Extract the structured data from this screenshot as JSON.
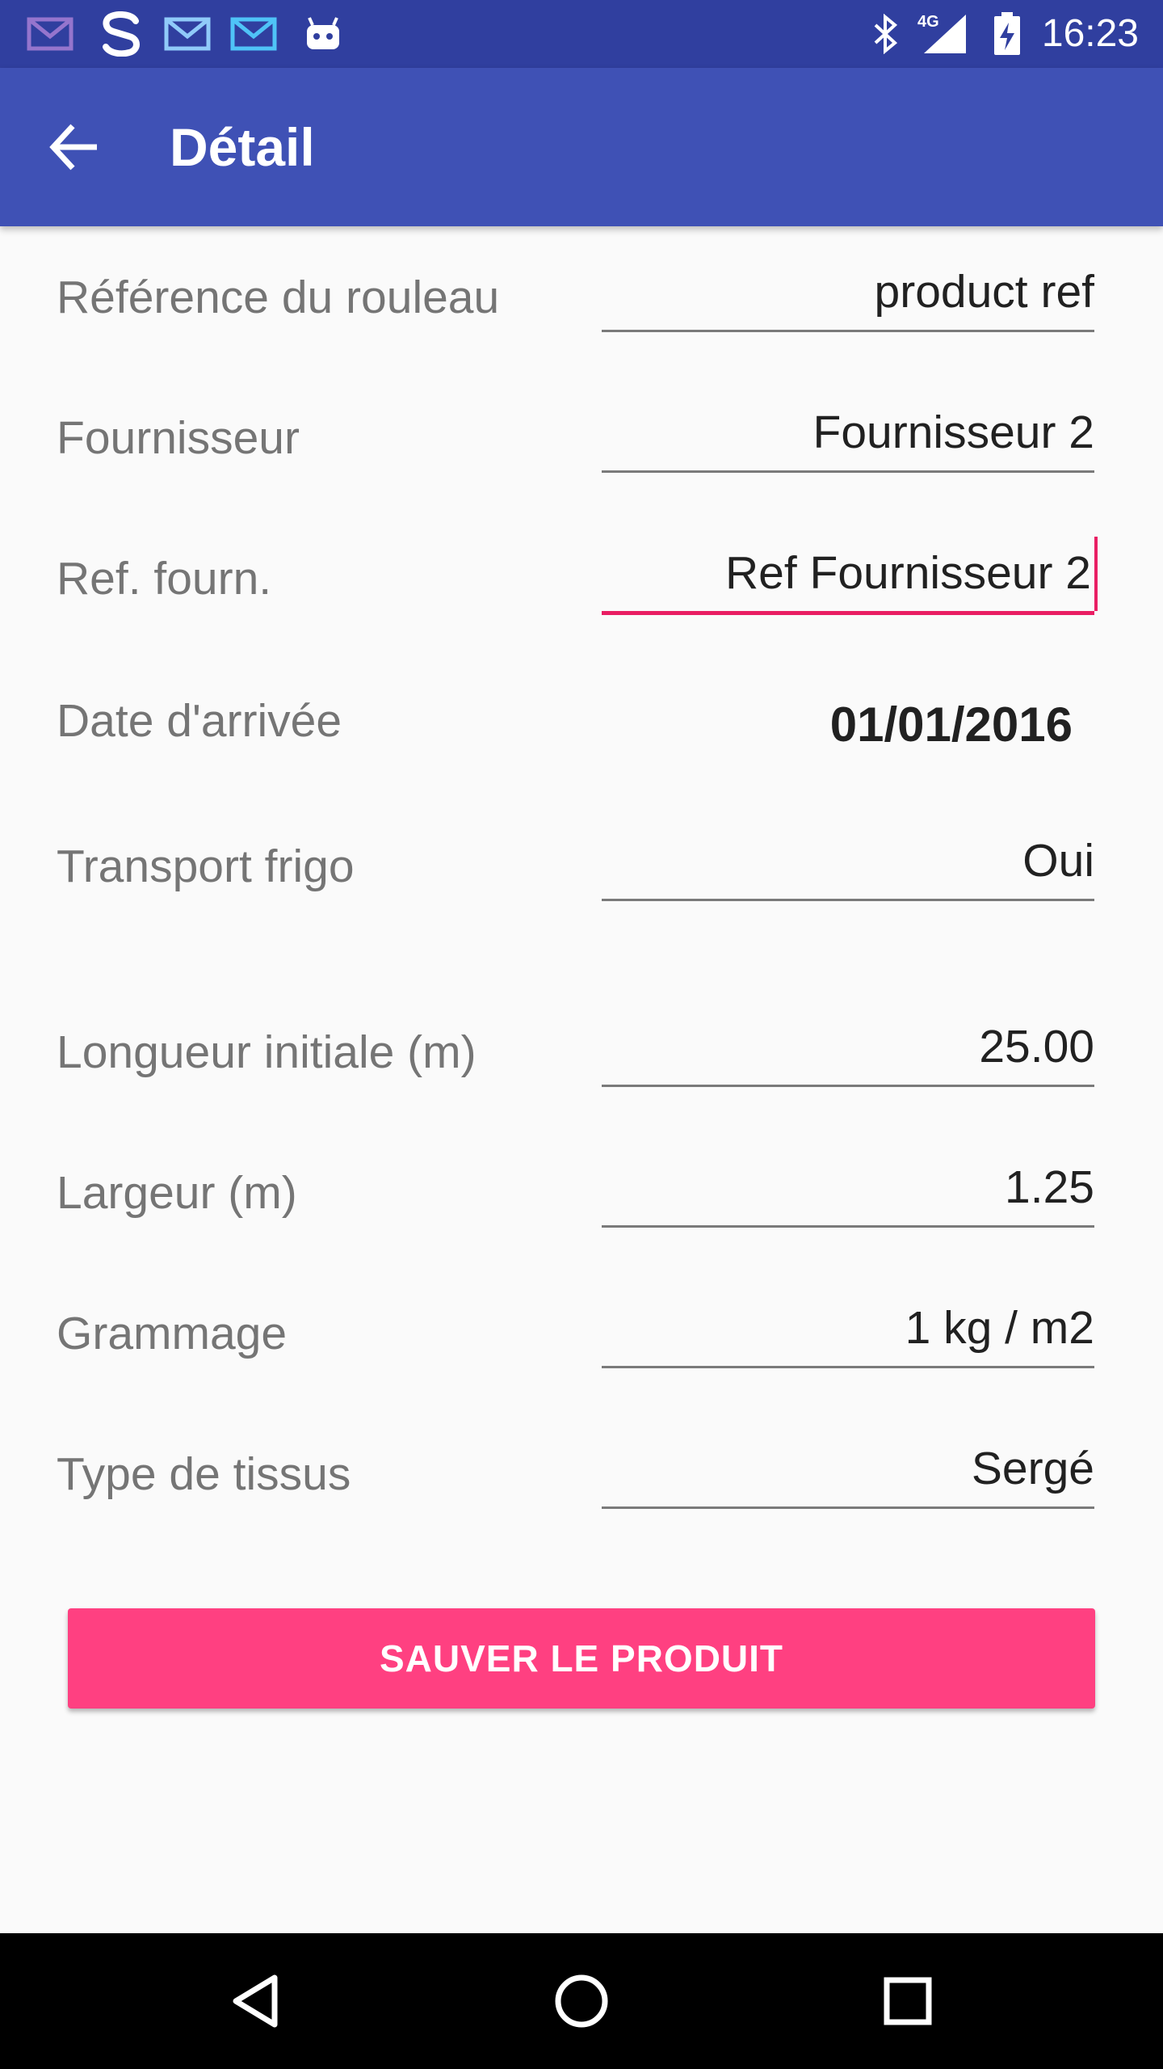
{
  "status_bar": {
    "time": "16:23",
    "network": "4G",
    "icons": [
      "mail-icon",
      "s-app-icon",
      "mail-icon",
      "mail-icon",
      "android-icon",
      "bluetooth-icon",
      "signal-icon",
      "battery-charging-icon"
    ]
  },
  "app_bar": {
    "title": "Détail",
    "back_icon": "arrow-back-icon"
  },
  "form": {
    "fields": [
      {
        "label": "Référence du rouleau",
        "value": "product ref"
      },
      {
        "label": "Fournisseur",
        "value": "Fournisseur 2"
      },
      {
        "label": "Ref. fourn.",
        "value": "Ref Fournisseur 2",
        "focused": true
      },
      {
        "label": "Date d'arrivée",
        "value": "01/01/2016"
      },
      {
        "label": "Transport frigo",
        "value": "Oui"
      },
      {
        "label": "Longueur initiale (m)",
        "value": "25.00"
      },
      {
        "label": "Largeur (m)",
        "value": "1.25"
      },
      {
        "label": "Grammage",
        "value": "1 kg / m2"
      },
      {
        "label": "Type de tissus",
        "value": "Sergé"
      }
    ]
  },
  "save_button": {
    "label": "SAUVER LE PRODUIT"
  },
  "nav_bar": {
    "icons": [
      "back-triangle-icon",
      "home-circle-icon",
      "recents-square-icon"
    ]
  },
  "colors": {
    "status_bar": "#303f9f",
    "app_bar": "#3f51b5",
    "accent": "#ff4081",
    "focus_underline": "#e91e63"
  }
}
